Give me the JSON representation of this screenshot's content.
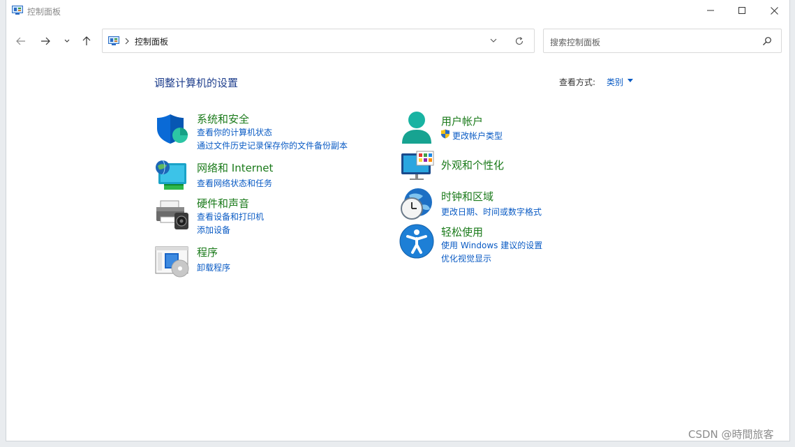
{
  "window": {
    "title": "控制面板"
  },
  "address": {
    "path_item": "控制面板"
  },
  "search": {
    "placeholder": "搜索控制面板"
  },
  "main": {
    "heading": "调整计算机的设置",
    "view_by_label": "查看方式:",
    "view_by_value": "类别"
  },
  "categories": [
    {
      "title": "系统和安全",
      "links": [
        "查看你的计算机状态",
        "通过文件历史记录保存你的文件备份副本"
      ]
    },
    {
      "title": "网络和 Internet",
      "links": [
        "查看网络状态和任务"
      ]
    },
    {
      "title": "硬件和声音",
      "links": [
        "查看设备和打印机",
        "添加设备"
      ]
    },
    {
      "title": "程序",
      "links": [
        "卸载程序"
      ]
    },
    {
      "title": "用户帐户",
      "links": [
        "更改帐户类型"
      ]
    },
    {
      "title": "外观和个性化",
      "links": []
    },
    {
      "title": "时钟和区域",
      "links": [
        "更改日期、时间或数字格式"
      ]
    },
    {
      "title": "轻松使用",
      "links": [
        "使用 Windows 建议的设置",
        "优化视觉显示"
      ]
    }
  ],
  "watermark": "CSDN @時間旅客",
  "colors": {
    "heading": "#1e3e8c",
    "category_title": "#1a7a1a",
    "link": "#0a5bc4"
  },
  "icons": {
    "window": "control-panel-icon",
    "back": "arrow-left-icon",
    "forward": "arrow-right-icon",
    "recent": "chevron-down-icon",
    "up": "arrow-up-icon",
    "refresh": "refresh-icon",
    "search": "search-icon"
  }
}
